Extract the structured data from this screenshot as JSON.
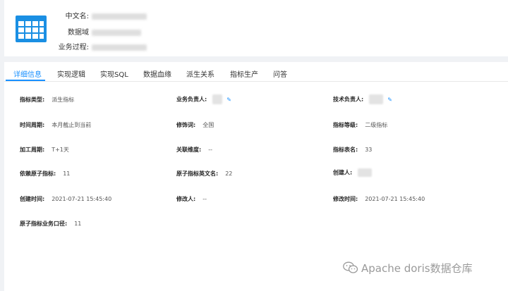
{
  "header": {
    "chinese_name_label": "中文名:",
    "data_domain_label": "数据域",
    "business_process_label": "业务过程:",
    "brand_color": "#1a8fe3",
    "icon": "table-grid-icon"
  },
  "tabs": [
    {
      "label": "详细信息",
      "active": true
    },
    {
      "label": "实现逻辑"
    },
    {
      "label": "实现SQL"
    },
    {
      "label": "数据血缘"
    },
    {
      "label": "派生关系"
    },
    {
      "label": "指标生产"
    },
    {
      "label": "问答"
    }
  ],
  "details": {
    "metric_type": {
      "label": "指标类型:",
      "value": "派生指标"
    },
    "business_owner": {
      "label": "业务负责人:"
    },
    "tech_owner": {
      "label": "技术负责人:"
    },
    "time_period": {
      "label": "时间周期:",
      "value": "本月截止到当前"
    },
    "modifier": {
      "label": "修饰词:",
      "value": "全国"
    },
    "metric_level": {
      "label": "指标等级:",
      "value": "二级指标"
    },
    "process_cycle": {
      "label": "加工周期:",
      "value": "T+1天"
    },
    "related_dimension": {
      "label": "关联维度:",
      "value": "--"
    },
    "metric_table_name": {
      "label": "指标表名:",
      "value": "33"
    },
    "atomic_metric": {
      "label": "依赖原子指标:",
      "value": "11"
    },
    "atomic_metric_en": {
      "label": "原子指标英文名:",
      "value": "22"
    },
    "creator": {
      "label": "创建人:"
    },
    "create_time": {
      "label": "创建时间:",
      "value": "2021-07-21 15:45:40"
    },
    "modified_by": {
      "label": "修改人:",
      "value": "--"
    },
    "modify_time": {
      "label": "修改时间:",
      "value": "2021-07-21 15:45:40"
    },
    "atomic_caliber": {
      "label": "原子指标业务口径:",
      "value": "11"
    }
  },
  "watermark": {
    "text": "Apache doris数据仓库",
    "icon": "wechat-icon"
  }
}
